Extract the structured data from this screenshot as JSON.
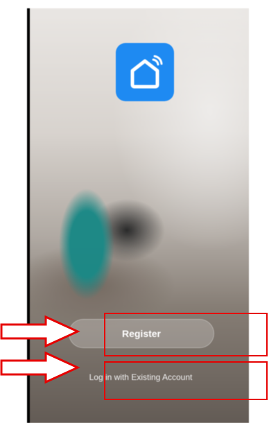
{
  "app": {
    "icon": "smart-home-wifi-icon",
    "accent": "#1e8af2"
  },
  "actions": {
    "register_label": "Register",
    "login_label": "Log in with Existing Account"
  },
  "annotation_colors": {
    "highlight": "#e60000"
  }
}
